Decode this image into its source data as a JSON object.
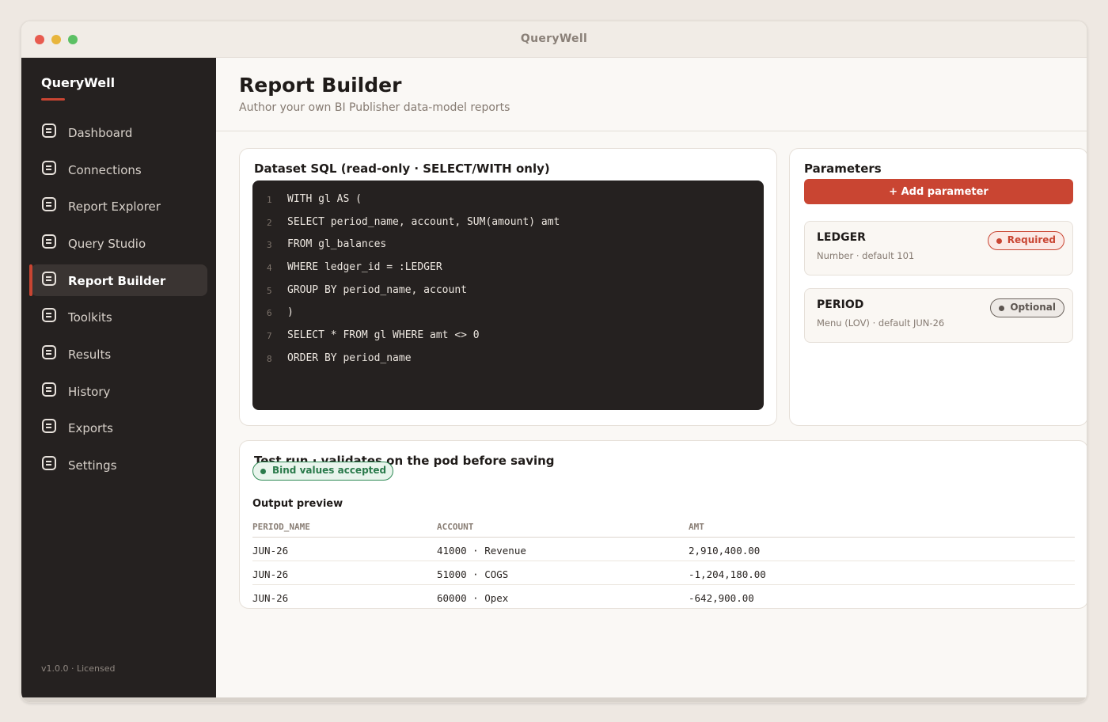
{
  "window": {
    "title": "QueryWell"
  },
  "sidebar": {
    "brand": "QueryWell",
    "items": [
      {
        "label": "Dashboard",
        "icon": "document-icon"
      },
      {
        "label": "Connections",
        "icon": "document-icon"
      },
      {
        "label": "Report Explorer",
        "icon": "document-icon"
      },
      {
        "label": "Query Studio",
        "icon": "document-icon"
      },
      {
        "label": "Report Builder",
        "icon": "document-icon",
        "active": true
      },
      {
        "label": "Toolkits",
        "icon": "document-icon"
      },
      {
        "label": "Results",
        "icon": "document-icon"
      },
      {
        "label": "History",
        "icon": "document-icon"
      },
      {
        "label": "Exports",
        "icon": "document-icon"
      },
      {
        "label": "Settings",
        "icon": "document-icon"
      }
    ],
    "version": "v1.0.0 · Licensed"
  },
  "header": {
    "title": "Report Builder",
    "subtitle": "Author your own BI Publisher data-model reports"
  },
  "sql": {
    "title": "Dataset SQL (read-only · SELECT/WITH only)",
    "lines": [
      {
        "n": "1",
        "text": "WITH gl AS ("
      },
      {
        "n": "2",
        "text": "SELECT period_name, account, SUM(amount) amt"
      },
      {
        "n": "3",
        "text": "FROM gl_balances"
      },
      {
        "n": "4",
        "text": "WHERE ledger_id = :LEDGER"
      },
      {
        "n": "5",
        "text": "GROUP BY period_name, account"
      },
      {
        "n": "6",
        "text": ")"
      },
      {
        "n": "7",
        "text": "SELECT * FROM gl WHERE amt <> 0"
      },
      {
        "n": "8",
        "text": "ORDER BY period_name"
      }
    ]
  },
  "parameters": {
    "title": "Parameters",
    "add_label": "+ Add parameter",
    "items": [
      {
        "name": "LEDGER",
        "desc": "Number · default 101",
        "badge": "Required"
      },
      {
        "name": "PERIOD",
        "desc": "Menu (LOV) · default JUN-26",
        "badge": "Optional"
      }
    ]
  },
  "test_run": {
    "title": "Test run · validates on the pod before saving",
    "status": "Bind values accepted",
    "preview_title": "Output preview",
    "columns": [
      "PERIOD_NAME",
      "ACCOUNT",
      "AMT"
    ],
    "rows": [
      [
        "JUN-26",
        "41000 · Revenue",
        "2,910,400.00"
      ],
      [
        "JUN-26",
        "51000 · COGS",
        "-1,204,180.00"
      ],
      [
        "JUN-26",
        "60000 · Opex",
        "-642,900.00"
      ]
    ]
  },
  "colors": {
    "accent": "#c94532",
    "sidebar": "#252120",
    "success": "#2a7a4b"
  }
}
